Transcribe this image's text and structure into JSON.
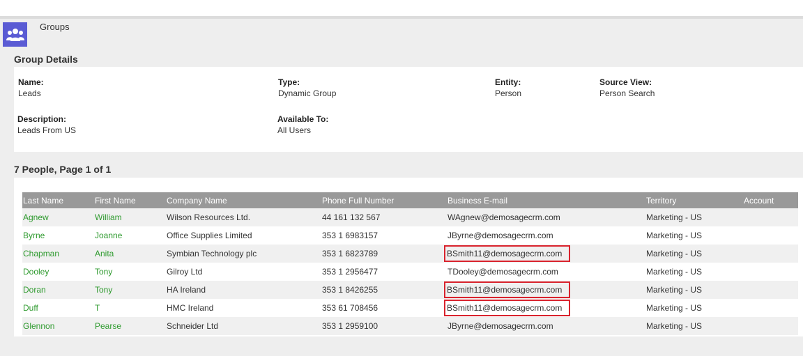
{
  "app": {
    "title": "Groups",
    "icon": "people-group-icon",
    "accent": "#5a5bd4"
  },
  "details": {
    "heading": "Group Details",
    "name_label": "Name:",
    "name": "Leads",
    "type_label": "Type:",
    "type": "Dynamic Group",
    "entity_label": "Entity:",
    "entity": "Person",
    "source_label": "Source View:",
    "source": "Person Search",
    "description_label": "Description:",
    "description": "Leads From US",
    "available_label": "Available To:",
    "available": "All Users"
  },
  "list": {
    "heading": "7 People, Page 1 of 1",
    "columns": [
      "Last Name",
      "First Name",
      "Company Name",
      "Phone Full Number",
      "Business E-mail",
      "Territory",
      "Account"
    ],
    "rows": [
      {
        "last": "Agnew",
        "first": "William",
        "company": "Wilson Resources Ltd.",
        "phone": "44 161 132 567",
        "email": "WAgnew@demosagecrm.com",
        "territory": "Marketing - US",
        "account": "",
        "highlight": false
      },
      {
        "last": "Byrne",
        "first": "Joanne",
        "company": "Office Supplies Limited",
        "phone": "353 1 6983157",
        "email": "JByrne@demosagecrm.com",
        "territory": "Marketing - US",
        "account": "",
        "highlight": false
      },
      {
        "last": "Chapman",
        "first": "Anita",
        "company": "Symbian Technology plc",
        "phone": "353 1 6823789",
        "email": "BSmith11@demosagecrm.com",
        "territory": "Marketing - US",
        "account": "",
        "highlight": true
      },
      {
        "last": "Dooley",
        "first": "Tony",
        "company": "Gilroy Ltd",
        "phone": "353 1 2956477",
        "email": "TDooley@demosagecrm.com",
        "territory": "Marketing - US",
        "account": "",
        "highlight": false
      },
      {
        "last": "Doran",
        "first": "Tony",
        "company": "HA Ireland",
        "phone": "353 1 8426255",
        "email": "BSmith11@demosagecrm.com",
        "territory": "Marketing - US",
        "account": "",
        "highlight": true
      },
      {
        "last": "Duff",
        "first": "T",
        "company": "HMC Ireland",
        "phone": "353 61 708456",
        "email": "BSmith11@demosagecrm.com",
        "territory": "Marketing - US",
        "account": "",
        "highlight": true
      },
      {
        "last": "Glennon",
        "first": "Pearse",
        "company": "Schneider Ltd",
        "phone": "353 1 2959100",
        "email": "JByrne@demosagecrm.com",
        "territory": "Marketing - US",
        "account": "",
        "highlight": false
      }
    ]
  },
  "colors": {
    "link": "#2e9a2e",
    "header_bg": "#999999",
    "highlight_border": "#d9232d"
  }
}
